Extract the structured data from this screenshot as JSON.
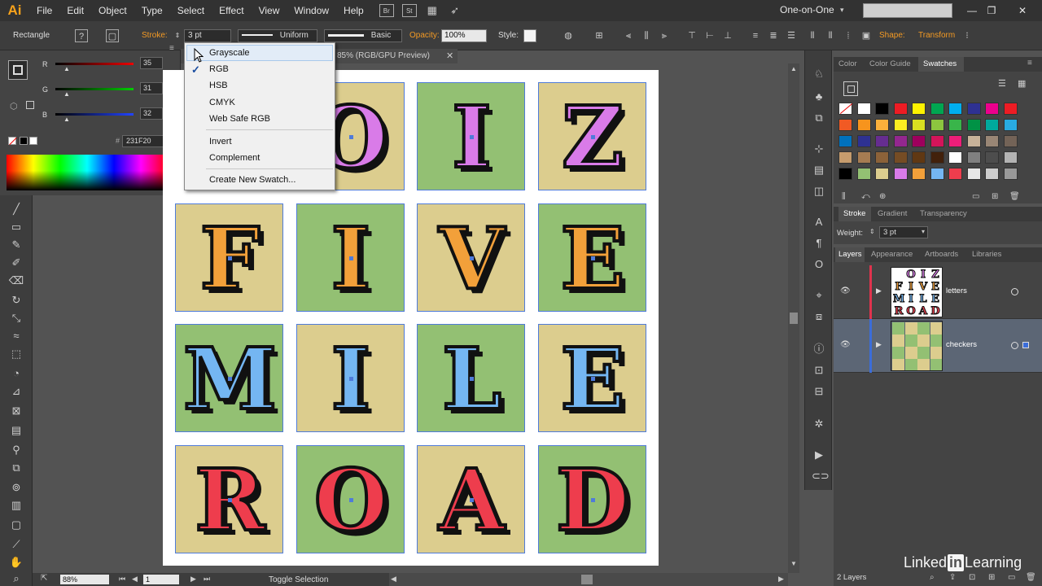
{
  "app": {
    "logo": "Ai"
  },
  "menu": [
    "File",
    "Edit",
    "Object",
    "Type",
    "Select",
    "Effect",
    "View",
    "Window",
    "Help"
  ],
  "menubar_buttons": {
    "bridge": "Br",
    "stock": "St"
  },
  "workspace": "One-on-One",
  "window_controls": {
    "minimize": "—",
    "restore": "❐",
    "close": "✕"
  },
  "control_bar": {
    "object_type": "Rectangle",
    "stroke_label": "Stroke:",
    "stroke_value": "3 pt",
    "profile": "Uniform",
    "brush": "Basic",
    "opacity_label": "Opacity:",
    "opacity_value": "100%",
    "style_label": "Style:",
    "shape_label": "Shape:",
    "transform_label": "Transform"
  },
  "color_panel": {
    "r_label": "R",
    "r_value": "35",
    "g_label": "G",
    "g_value": "31",
    "b_label": "B",
    "b_value": "32",
    "hex_value": "231F20",
    "fill_color": "#231F20"
  },
  "color_mode_menu": {
    "items": [
      "Grayscale",
      "RGB",
      "HSB",
      "CMYK",
      "Web Safe RGB"
    ],
    "items2": [
      "Invert",
      "Complement"
    ],
    "items3": [
      "Create New Swatch..."
    ],
    "checked": "RGB",
    "check_mark": "✓"
  },
  "document_tab": {
    "title": "85% (RGB/GPU Preview)",
    "close": "✕"
  },
  "artboard": {
    "tiles": [
      {
        "letter": "O",
        "bg": "#dccd8e",
        "color": "#d97be8"
      },
      {
        "letter": "I",
        "bg": "#93c073",
        "color": "#d97be8"
      },
      {
        "letter": "Z",
        "bg": "#dccd8e",
        "color": "#d97be8"
      },
      {
        "letter": "F",
        "bg": "#dccd8e",
        "color": "#f2a03a"
      },
      {
        "letter": "I",
        "bg": "#93c073",
        "color": "#f2a03a"
      },
      {
        "letter": "V",
        "bg": "#dccd8e",
        "color": "#f2a03a"
      },
      {
        "letter": "E",
        "bg": "#93c073",
        "color": "#f2a03a"
      },
      {
        "letter": "M",
        "bg": "#93c073",
        "color": "#74b6f2"
      },
      {
        "letter": "I",
        "bg": "#dccd8e",
        "color": "#74b6f2"
      },
      {
        "letter": "L",
        "bg": "#93c073",
        "color": "#74b6f2"
      },
      {
        "letter": "E",
        "bg": "#dccd8e",
        "color": "#74b6f2"
      },
      {
        "letter": "R",
        "bg": "#dccd8e",
        "color": "#ee3d4d"
      },
      {
        "letter": "O",
        "bg": "#93c073",
        "color": "#ee3d4d"
      },
      {
        "letter": "A",
        "bg": "#dccd8e",
        "color": "#ee3d4d"
      },
      {
        "letter": "D",
        "bg": "#93c073",
        "color": "#ee3d4d"
      }
    ]
  },
  "status_bar": {
    "zoom": "88%",
    "page": "1",
    "toggle": "Toggle Selection"
  },
  "swatches_panel": {
    "tabs": [
      "Color",
      "Color Guide",
      "Swatches"
    ],
    "active": "Swatches",
    "colors": [
      "#ffffff",
      "#ffffff",
      "#000000",
      "#ed1c24",
      "#fff200",
      "#00a651",
      "#00aeef",
      "#2e3192",
      "#ec008c",
      "#ed1c24",
      "#f15a24",
      "#f7941d",
      "#fbb03b",
      "#fcee21",
      "#d9e021",
      "#8cc63f",
      "#39b54a",
      "#009245",
      "#00a99d",
      "#29abe2",
      "#0071bc",
      "#2e3192",
      "#662d91",
      "#93278f",
      "#9e005d",
      "#d4145a",
      "#ed1e79",
      "#c7b299",
      "#998675",
      "#736357",
      "#c69c6d",
      "#a67c52",
      "#8c6239",
      "#754c24",
      "#603813",
      "#42210b",
      "#ffffff",
      "#808080",
      "#4d4d4d",
      "#b3b3b3",
      "#000000",
      "#93c073",
      "#dccd8e",
      "#d97be8",
      "#f2a03a",
      "#74b6f2",
      "#ee3d4d",
      "#e6e6e6",
      "#cccccc",
      "#999999"
    ]
  },
  "stroke_panel": {
    "tabs": [
      "Stroke",
      "Gradient",
      "Transparency"
    ],
    "weight_label": "Weight:",
    "weight_value": "3 pt"
  },
  "layers_panel": {
    "tabs": [
      "Layers",
      "Appearance",
      "Artboards",
      "Libraries"
    ],
    "layers": [
      {
        "name": "letters",
        "color": "#e0334d"
      },
      {
        "name": "checkers",
        "color": "#3b6dd9"
      }
    ],
    "count": "2 Layers"
  },
  "watermark": {
    "pre": "Linked",
    "box": "in",
    "post": "Learning"
  }
}
